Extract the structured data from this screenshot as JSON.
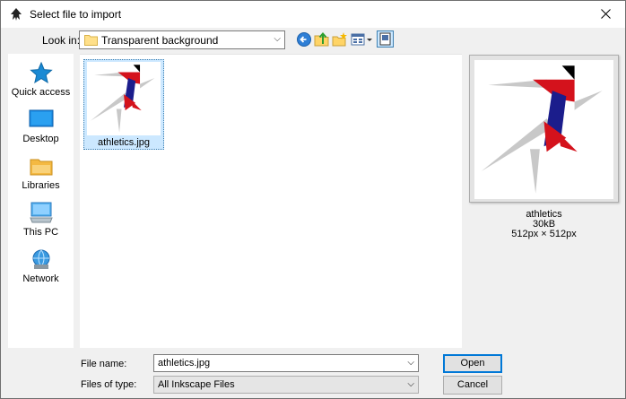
{
  "window": {
    "title": "Select file to import"
  },
  "toolbar": {
    "look_in_label": "Look in:",
    "look_in_value": "Transparent background"
  },
  "places": [
    {
      "label": "Quick access",
      "icon": "star-icon"
    },
    {
      "label": "Desktop",
      "icon": "desktop-icon"
    },
    {
      "label": "Libraries",
      "icon": "libraries-icon"
    },
    {
      "label": "This PC",
      "icon": "computer-icon"
    },
    {
      "label": "Network",
      "icon": "network-icon"
    }
  ],
  "files": [
    {
      "name": "athletics.jpg",
      "selected": true
    }
  ],
  "preview": {
    "name": "athletics",
    "size": "30kB",
    "dimensions": "512px × 512px"
  },
  "form": {
    "file_name_label": "File name:",
    "file_name_value": "athletics.jpg",
    "files_of_type_label": "Files of type:",
    "files_of_type_value": "All Inkscape Files",
    "open_label": "Open",
    "cancel_label": "Cancel"
  },
  "colors": {
    "selection": "#cce8ff",
    "accent": "#0078d7",
    "athlete_red": "#d4121c",
    "athlete_blue": "#1b1d8c",
    "shadow_gray": "#c8c8c8"
  }
}
